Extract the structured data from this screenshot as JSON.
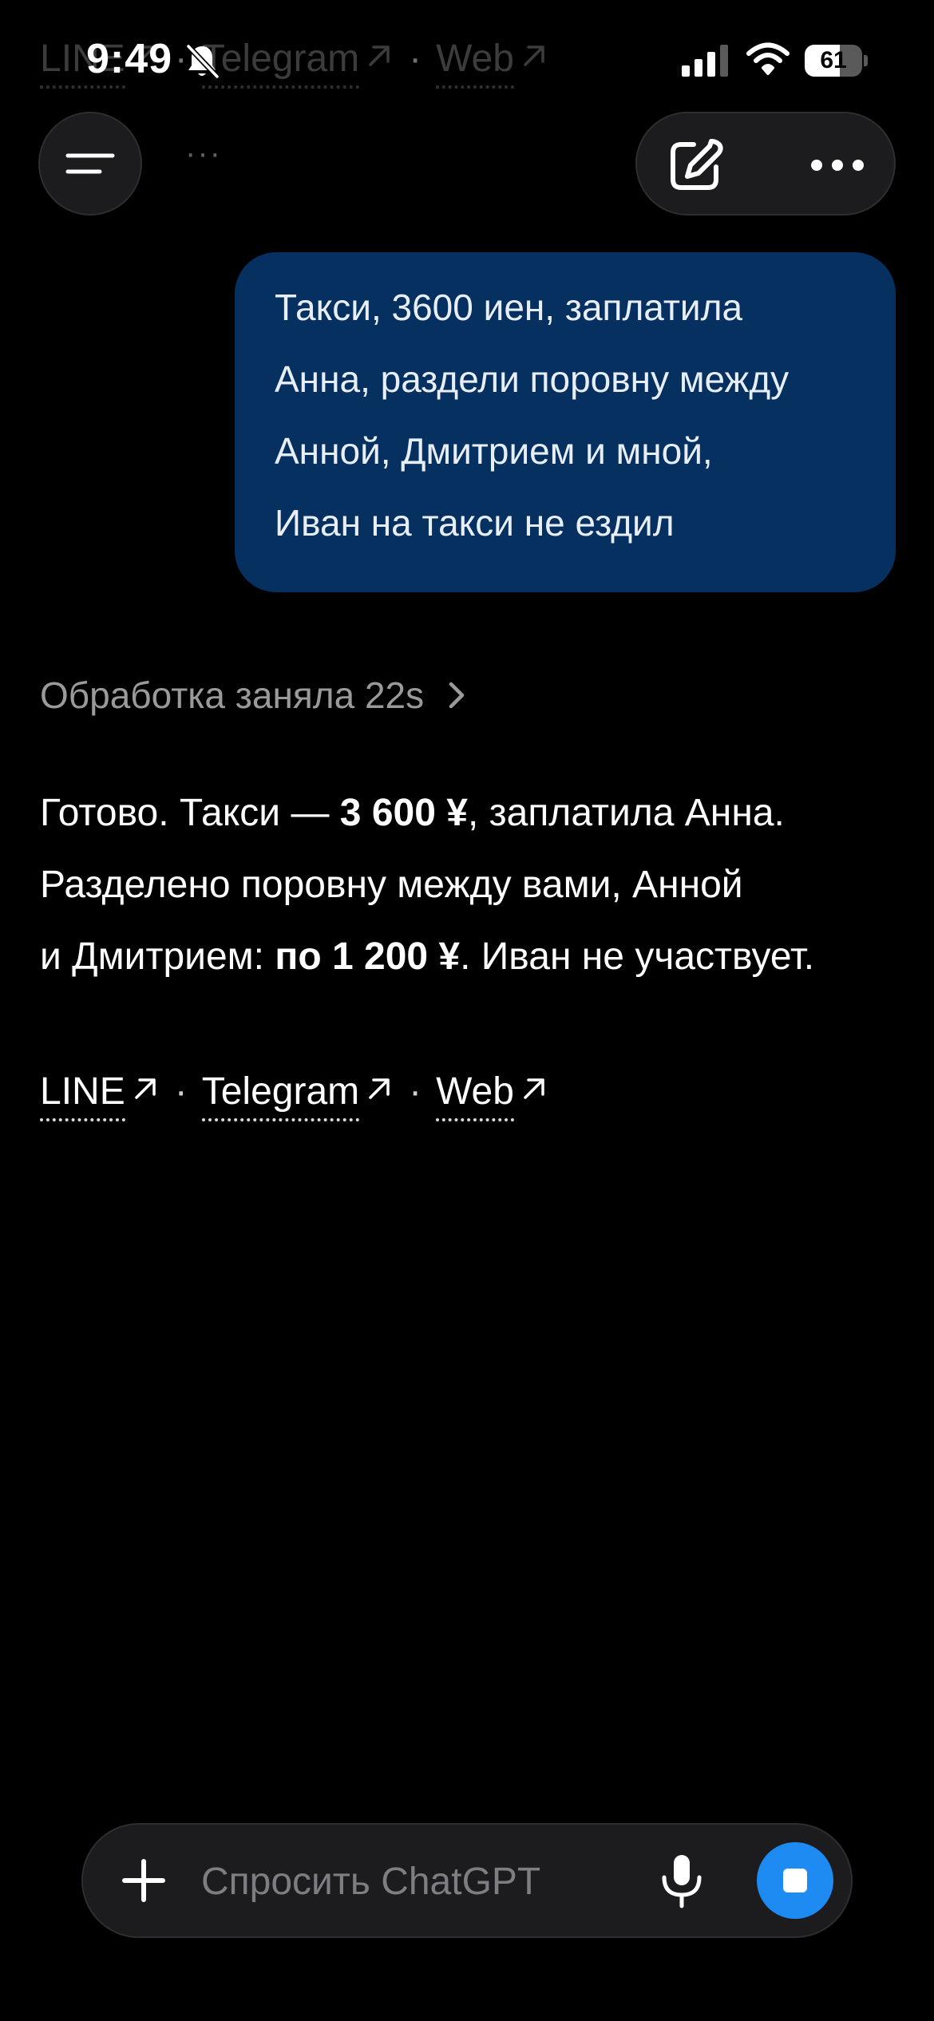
{
  "status_bar": {
    "time": "9:49",
    "battery_level": "61",
    "battery_fraction": 0.61
  },
  "toolbar": {
    "menu_icon": "hamburger-icon",
    "new_chat_icon": "compose-icon",
    "more_icon": "more-dots-icon",
    "ghost_dots": "···"
  },
  "conversation": {
    "user_message_lines": [
      "Такси, 3600 иен, заплатила",
      "Анна, раздели поровну между",
      "Анной, Дмитрием и мной,",
      "Иван на такси не ездил"
    ],
    "thinking_label": "Обработка заняла 22s",
    "answer": {
      "line1_a": "Готово. Такси — ",
      "line1_b": "3 600 ¥",
      "line1_c": ", заплатила Анна.",
      "line2": "Разделено поровну между вами, Анной",
      "line3_a": "и Дмитрием: ",
      "line3_b": "по 1 200 ¥",
      "line3_c": ". Иван не участвует."
    },
    "links": [
      {
        "label": "LINE"
      },
      {
        "label": "Telegram"
      },
      {
        "label": "Web"
      }
    ],
    "link_separator": "·"
  },
  "composer": {
    "placeholder": "Спросить ChatGPT",
    "plus_icon": "plus-icon",
    "mic_icon": "microphone-icon",
    "stop_icon": "stop-icon",
    "accent_color": "#1d8bf1"
  },
  "colors": {
    "background": "#000000",
    "user_bubble": "#06305f",
    "muted_text": "#9a9a9a"
  }
}
